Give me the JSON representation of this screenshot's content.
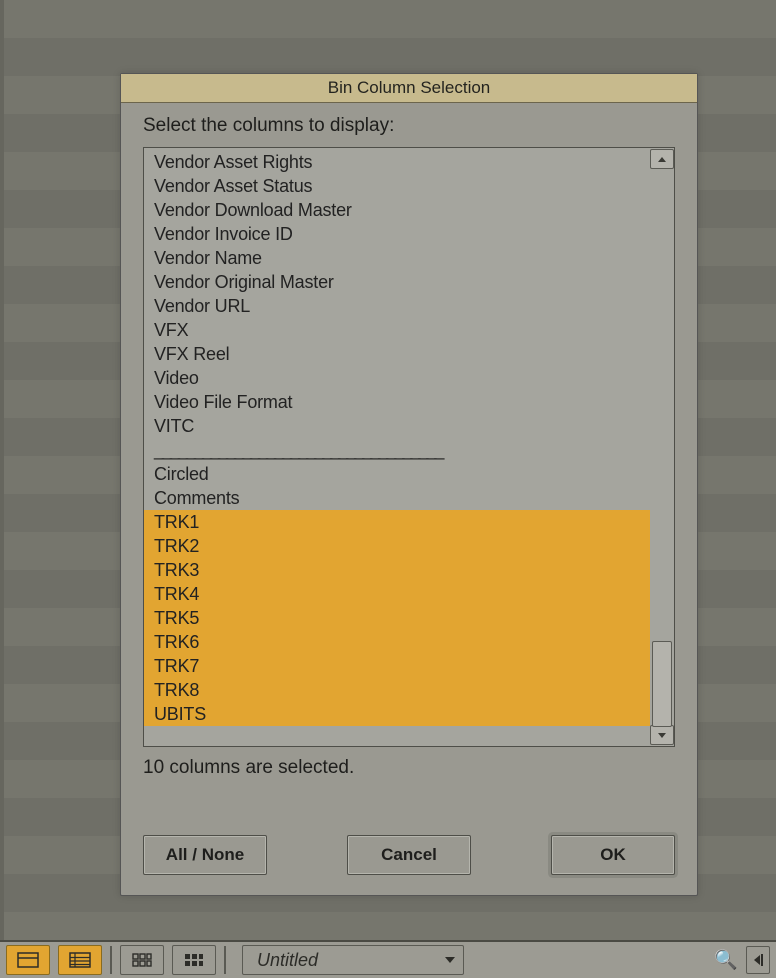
{
  "dialog": {
    "title": "Bin Column Selection",
    "instruction": "Select the columns to display:",
    "status": "10 columns are selected.",
    "buttons": {
      "all_none": "All / None",
      "cancel": "Cancel",
      "ok": "OK"
    },
    "items": [
      {
        "label": "Vendor Asset Rights",
        "selected": false
      },
      {
        "label": "Vendor Asset Status",
        "selected": false
      },
      {
        "label": "Vendor Download Master",
        "selected": false
      },
      {
        "label": "Vendor Invoice ID",
        "selected": false
      },
      {
        "label": "Vendor Name",
        "selected": false
      },
      {
        "label": "Vendor Original Master",
        "selected": false
      },
      {
        "label": "Vendor URL",
        "selected": false
      },
      {
        "label": "VFX",
        "selected": false
      },
      {
        "label": "VFX Reel",
        "selected": false
      },
      {
        "label": "Video",
        "selected": false
      },
      {
        "label": "Video File Format",
        "selected": false
      },
      {
        "label": "VITC",
        "selected": false
      },
      {
        "label": "____________________________________",
        "selected": false,
        "divider": true
      },
      {
        "label": "Circled",
        "selected": false
      },
      {
        "label": "Comments",
        "selected": false
      },
      {
        "label": "TRK1",
        "selected": true
      },
      {
        "label": "TRK2",
        "selected": true
      },
      {
        "label": "TRK3",
        "selected": true
      },
      {
        "label": "TRK4",
        "selected": true
      },
      {
        "label": "TRK5",
        "selected": true
      },
      {
        "label": "TRK6",
        "selected": true
      },
      {
        "label": "TRK7",
        "selected": true
      },
      {
        "label": "TRK8",
        "selected": true
      },
      {
        "label": "UBITS",
        "selected": true
      }
    ]
  },
  "bottombar": {
    "views": [
      {
        "name": "view-split",
        "active": true
      },
      {
        "name": "view-list",
        "active": true
      },
      {
        "name": "view-grid",
        "active": false
      },
      {
        "name": "view-grid-lg",
        "active": false
      }
    ],
    "tab_label": "Untitled",
    "search_icon": "search-icon"
  }
}
